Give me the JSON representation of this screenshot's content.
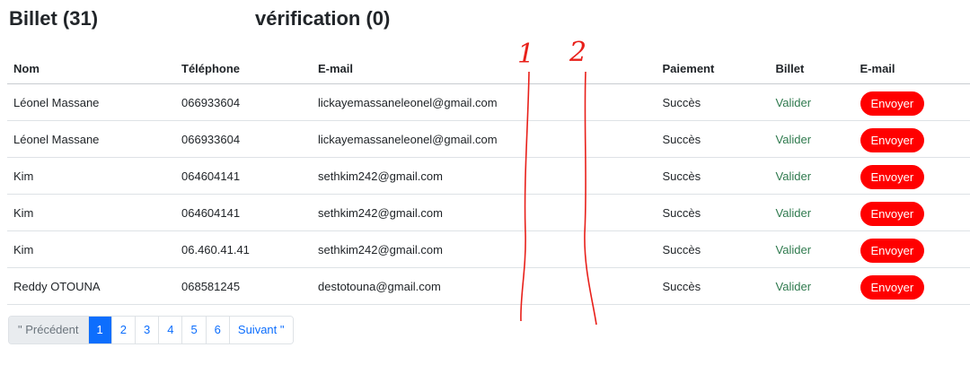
{
  "headings": {
    "billet": "Billet (31)",
    "verification": "vérification (0)"
  },
  "table": {
    "columns": [
      "Nom",
      "Téléphone",
      "E-mail",
      "",
      "Paiement",
      "Billet",
      "E-mail"
    ],
    "rows": [
      {
        "nom": "Léonel Massane",
        "tel": "066933604",
        "email": "lickayemassaneleonel@gmail.com",
        "paiement": "Succès",
        "billet": "Valider",
        "action": "Envoyer"
      },
      {
        "nom": "Léonel Massane",
        "tel": "066933604",
        "email": "lickayemassaneleonel@gmail.com",
        "paiement": "Succès",
        "billet": "Valider",
        "action": "Envoyer"
      },
      {
        "nom": "Kim",
        "tel": "064604141",
        "email": "sethkim242@gmail.com",
        "paiement": "Succès",
        "billet": "Valider",
        "action": "Envoyer"
      },
      {
        "nom": "Kim",
        "tel": "064604141",
        "email": "sethkim242@gmail.com",
        "paiement": "Succès",
        "billet": "Valider",
        "action": "Envoyer"
      },
      {
        "nom": "Kim",
        "tel": "06.460.41.41",
        "email": "sethkim242@gmail.com",
        "paiement": "Succès",
        "billet": "Valider",
        "action": "Envoyer"
      },
      {
        "nom": "Reddy OTOUNA",
        "tel": "068581245",
        "email": "destotouna@gmail.com",
        "paiement": "Succès",
        "billet": "Valider",
        "action": "Envoyer"
      }
    ]
  },
  "pagination": {
    "prev": "\" Précédent",
    "pages": [
      "1",
      "2",
      "3",
      "4",
      "5",
      "6"
    ],
    "active": "1",
    "next": "Suivant \""
  },
  "annotations": {
    "marks": [
      "1",
      "2"
    ],
    "color": "#e8201a"
  },
  "colors": {
    "send_button": "#ff0000",
    "valider_link": "#2f7a4e",
    "page_active": "#0d6efd"
  }
}
